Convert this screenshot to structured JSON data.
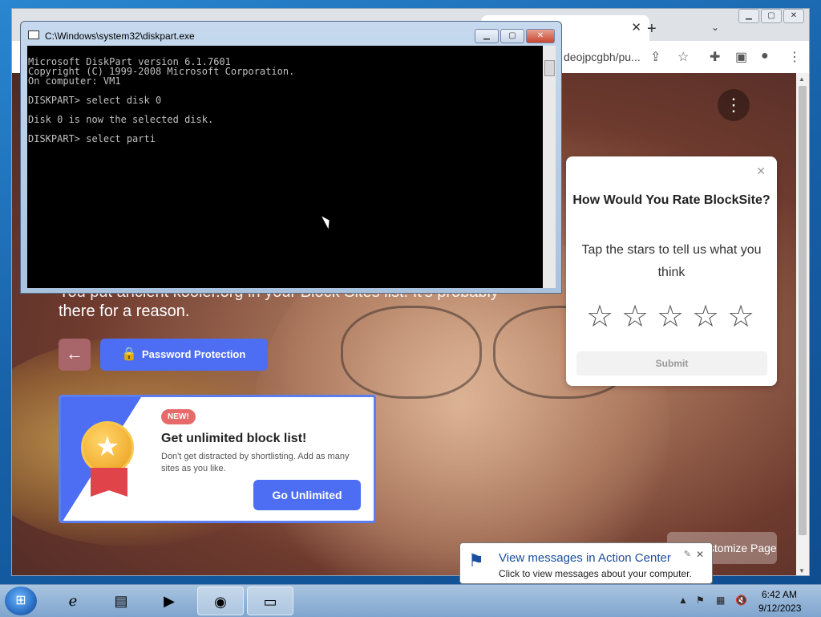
{
  "console": {
    "title": "C:\\Windows\\system32\\diskpart.exe",
    "lines": "Microsoft DiskPart version 6.1.7601\nCopyright (C) 1999-2008 Microsoft Corporation.\nOn computer: VM1\n\nDISKPART> select disk 0\n\nDisk 0 is now the selected disk.\n\nDISKPART> select parti"
  },
  "browser": {
    "url_fragment": "deojpcgbh/pu...",
    "blocked_message_line1": "You put ancient kooler.org in your Block Sites list. It's probably",
    "blocked_message_line2": "there for a reason.",
    "password_button": "Password Protection",
    "customize_button": "Customize Page"
  },
  "promo": {
    "badge": "NEW!",
    "title": "Get unlimited block list!",
    "description": "Don't get distracted by shortlisting. Add as many sites as you like.",
    "button": "Go Unlimited"
  },
  "rating": {
    "title": "How Would You Rate BlockSite?",
    "subtitle": "Tap the stars to tell us what you think",
    "stars": 5,
    "submit": "Submit"
  },
  "notification": {
    "title": "View messages in Action Center",
    "text": "Click to view messages about your computer."
  },
  "clock": {
    "time": "6:42 AM",
    "date": "9/12/2023"
  }
}
